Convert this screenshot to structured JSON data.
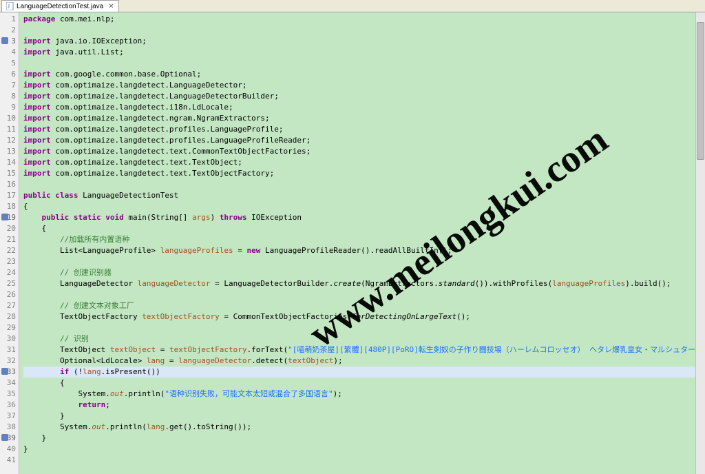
{
  "tab": {
    "icon": "java-file-icon",
    "title": "LanguageDetectionTest.java",
    "close": "✕"
  },
  "watermark": "www.meilongkui.com",
  "code": {
    "lines": [
      {
        "n": 1,
        "marked": false,
        "tokens": [
          {
            "t": "package",
            "c": "kw"
          },
          {
            "t": " com.mei.nlp;",
            "c": ""
          }
        ]
      },
      {
        "n": 2,
        "marked": false,
        "tokens": []
      },
      {
        "n": 3,
        "marked": true,
        "tokens": [
          {
            "t": "import",
            "c": "kw"
          },
          {
            "t": " java.io.IOException;",
            "c": ""
          }
        ]
      },
      {
        "n": 4,
        "marked": false,
        "tokens": [
          {
            "t": "import",
            "c": "kw"
          },
          {
            "t": " java.util.List;",
            "c": ""
          }
        ]
      },
      {
        "n": 5,
        "marked": false,
        "tokens": []
      },
      {
        "n": 6,
        "marked": false,
        "tokens": [
          {
            "t": "import",
            "c": "kw"
          },
          {
            "t": " com.google.common.base.Optional;",
            "c": ""
          }
        ]
      },
      {
        "n": 7,
        "marked": false,
        "tokens": [
          {
            "t": "import",
            "c": "kw"
          },
          {
            "t": " com.optimaize.langdetect.LanguageDetector;",
            "c": ""
          }
        ]
      },
      {
        "n": 8,
        "marked": false,
        "tokens": [
          {
            "t": "import",
            "c": "kw"
          },
          {
            "t": " com.optimaize.langdetect.LanguageDetectorBuilder;",
            "c": ""
          }
        ]
      },
      {
        "n": 9,
        "marked": false,
        "tokens": [
          {
            "t": "import",
            "c": "kw"
          },
          {
            "t": " com.optimaize.langdetect.i18n.LdLocale;",
            "c": ""
          }
        ]
      },
      {
        "n": 10,
        "marked": false,
        "tokens": [
          {
            "t": "import",
            "c": "kw"
          },
          {
            "t": " com.optimaize.langdetect.ngram.NgramExtractors;",
            "c": ""
          }
        ]
      },
      {
        "n": 11,
        "marked": false,
        "tokens": [
          {
            "t": "import",
            "c": "kw"
          },
          {
            "t": " com.optimaize.langdetect.profiles.LanguageProfile;",
            "c": ""
          }
        ]
      },
      {
        "n": 12,
        "marked": false,
        "tokens": [
          {
            "t": "import",
            "c": "kw"
          },
          {
            "t": " com.optimaize.langdetect.profiles.LanguageProfileReader;",
            "c": ""
          }
        ]
      },
      {
        "n": 13,
        "marked": false,
        "tokens": [
          {
            "t": "import",
            "c": "kw"
          },
          {
            "t": " com.optimaize.langdetect.text.CommonTextObjectFactories;",
            "c": ""
          }
        ]
      },
      {
        "n": 14,
        "marked": false,
        "tokens": [
          {
            "t": "import",
            "c": "kw"
          },
          {
            "t": " com.optimaize.langdetect.text.TextObject;",
            "c": ""
          }
        ]
      },
      {
        "n": 15,
        "marked": false,
        "tokens": [
          {
            "t": "import",
            "c": "kw"
          },
          {
            "t": " com.optimaize.langdetect.text.TextObjectFactory;",
            "c": ""
          }
        ]
      },
      {
        "n": 16,
        "marked": false,
        "tokens": []
      },
      {
        "n": 17,
        "marked": false,
        "tokens": [
          {
            "t": "public class",
            "c": "kw"
          },
          {
            "t": " LanguageDetectionTest",
            "c": ""
          }
        ]
      },
      {
        "n": 18,
        "marked": false,
        "tokens": [
          {
            "t": "{",
            "c": ""
          }
        ]
      },
      {
        "n": 19,
        "marked": true,
        "tokens": [
          {
            "t": "    ",
            "c": ""
          },
          {
            "t": "public static void",
            "c": "kw"
          },
          {
            "t": " main(String[] ",
            "c": ""
          },
          {
            "t": "args",
            "c": "var"
          },
          {
            "t": ") ",
            "c": ""
          },
          {
            "t": "throws",
            "c": "kw"
          },
          {
            "t": " IOException",
            "c": ""
          }
        ]
      },
      {
        "n": 20,
        "marked": false,
        "tokens": [
          {
            "t": "    {",
            "c": ""
          }
        ]
      },
      {
        "n": 21,
        "marked": false,
        "tokens": [
          {
            "t": "        ",
            "c": ""
          },
          {
            "t": "//加载所有内置语种",
            "c": "com"
          }
        ]
      },
      {
        "n": 22,
        "marked": false,
        "tokens": [
          {
            "t": "        List<LanguageProfile> ",
            "c": ""
          },
          {
            "t": "languageProfiles",
            "c": "var"
          },
          {
            "t": " = ",
            "c": ""
          },
          {
            "t": "new",
            "c": "kw"
          },
          {
            "t": " LanguageProfileReader().readAllBuiltIn();",
            "c": ""
          }
        ]
      },
      {
        "n": 23,
        "marked": false,
        "tokens": []
      },
      {
        "n": 24,
        "marked": false,
        "tokens": [
          {
            "t": "        ",
            "c": ""
          },
          {
            "t": "// 创建识别器",
            "c": "com"
          }
        ]
      },
      {
        "n": 25,
        "marked": false,
        "tokens": [
          {
            "t": "        LanguageDetector ",
            "c": ""
          },
          {
            "t": "languageDetector",
            "c": "var"
          },
          {
            "t": " = LanguageDetectorBuilder.",
            "c": ""
          },
          {
            "t": "create",
            "c": "method-italic"
          },
          {
            "t": "(NgramExtractors.",
            "c": ""
          },
          {
            "t": "standard",
            "c": "method-italic"
          },
          {
            "t": "()).withProfiles(",
            "c": ""
          },
          {
            "t": "languageProfiles",
            "c": "var"
          },
          {
            "t": ").build();",
            "c": ""
          }
        ]
      },
      {
        "n": 26,
        "marked": false,
        "tokens": []
      },
      {
        "n": 27,
        "marked": false,
        "tokens": [
          {
            "t": "        ",
            "c": ""
          },
          {
            "t": "// 创建文本对象工厂",
            "c": "com"
          }
        ]
      },
      {
        "n": 28,
        "marked": false,
        "tokens": [
          {
            "t": "        TextObjectFactory ",
            "c": ""
          },
          {
            "t": "textObjectFactory",
            "c": "var"
          },
          {
            "t": " = CommonTextObjectFactories.",
            "c": ""
          },
          {
            "t": "forDetectingOnLargeText",
            "c": "method-italic"
          },
          {
            "t": "();",
            "c": ""
          }
        ]
      },
      {
        "n": 29,
        "marked": false,
        "tokens": []
      },
      {
        "n": 30,
        "marked": false,
        "tokens": [
          {
            "t": "        ",
            "c": ""
          },
          {
            "t": "// 识别",
            "c": "com"
          }
        ]
      },
      {
        "n": 31,
        "marked": false,
        "tokens": [
          {
            "t": "        TextObject ",
            "c": ""
          },
          {
            "t": "textObject",
            "c": "var"
          },
          {
            "t": " = ",
            "c": ""
          },
          {
            "t": "textObjectFactory",
            "c": "var"
          },
          {
            "t": ".forText(",
            "c": ""
          },
          {
            "t": "\"[喵萌奶茶屋][繁體][480P][PoRO]転生剣奴の子作り闘技場（ハーレムコロッセオ） ヘタレ爆乳皇女・マルシュタール～お漏らし鎧の折檻\"",
            "c": "str"
          },
          {
            "t": ");",
            "c": ""
          }
        ]
      },
      {
        "n": 32,
        "marked": false,
        "tokens": [
          {
            "t": "        Optional<LdLocale> ",
            "c": ""
          },
          {
            "t": "lang",
            "c": "var"
          },
          {
            "t": " = ",
            "c": ""
          },
          {
            "t": "languageDetector",
            "c": "var"
          },
          {
            "t": ".detect(",
            "c": ""
          },
          {
            "t": "textObject",
            "c": "var"
          },
          {
            "t": ");",
            "c": ""
          }
        ]
      },
      {
        "n": 33,
        "marked": true,
        "hl": true,
        "tokens": [
          {
            "t": "        ",
            "c": ""
          },
          {
            "t": "if",
            "c": "kw"
          },
          {
            "t": " (!",
            "c": ""
          },
          {
            "t": "lang",
            "c": "var"
          },
          {
            "t": ".isPresent())",
            "c": ""
          }
        ]
      },
      {
        "n": 34,
        "marked": false,
        "tokens": [
          {
            "t": "        {",
            "c": ""
          }
        ]
      },
      {
        "n": 35,
        "marked": false,
        "tokens": [
          {
            "t": "            System.",
            "c": ""
          },
          {
            "t": "out",
            "c": "var method-italic"
          },
          {
            "t": ".println(",
            "c": ""
          },
          {
            "t": "\"语种识别失败，可能文本太短或混合了多国语言\"",
            "c": "str"
          },
          {
            "t": ");",
            "c": ""
          }
        ]
      },
      {
        "n": 36,
        "marked": false,
        "tokens": [
          {
            "t": "            ",
            "c": ""
          },
          {
            "t": "return",
            "c": "kw"
          },
          {
            "t": ";",
            "c": ""
          }
        ]
      },
      {
        "n": 37,
        "marked": false,
        "tokens": [
          {
            "t": "        }",
            "c": ""
          }
        ]
      },
      {
        "n": 38,
        "marked": false,
        "tokens": [
          {
            "t": "        System.",
            "c": ""
          },
          {
            "t": "out",
            "c": "var method-italic"
          },
          {
            "t": ".println(",
            "c": ""
          },
          {
            "t": "lang",
            "c": "var"
          },
          {
            "t": ".get().toString());",
            "c": ""
          }
        ]
      },
      {
        "n": 39,
        "marked": true,
        "tokens": [
          {
            "t": "    }",
            "c": ""
          }
        ]
      },
      {
        "n": 40,
        "marked": false,
        "tokens": [
          {
            "t": "}",
            "c": ""
          }
        ]
      },
      {
        "n": 41,
        "marked": false,
        "tokens": []
      }
    ]
  }
}
